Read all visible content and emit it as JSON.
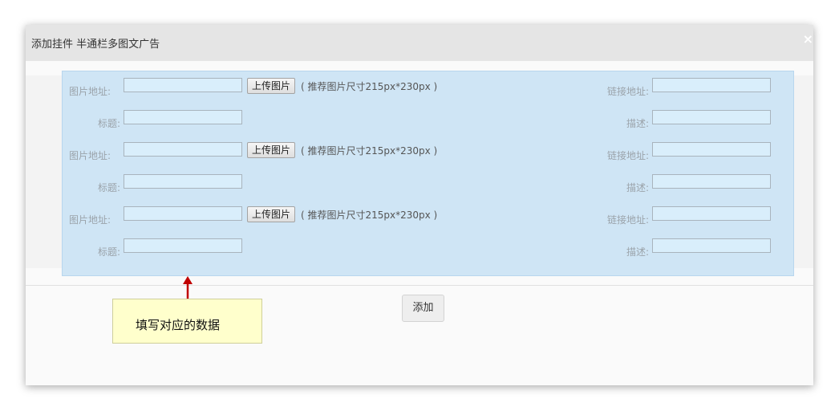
{
  "dialog": {
    "title": "添加挂件 半通栏多图文广告",
    "close_glyph": "×"
  },
  "form": {
    "rows": [
      {
        "image_label": "图片地址:",
        "upload_label": "上传图片",
        "hint": "( 推荐图片尺寸215px*230px )",
        "link_label": "链接地址:",
        "title_label": "标题:",
        "desc_label": "描述:",
        "image_value": "",
        "link_value": "",
        "title_value": "",
        "desc_value": ""
      },
      {
        "image_label": "图片地址:",
        "upload_label": "上传图片",
        "hint": "( 推荐图片尺寸215px*230px )",
        "link_label": "链接地址:",
        "title_label": "标题:",
        "desc_label": "描述:",
        "image_value": "",
        "link_value": "",
        "title_value": "",
        "desc_value": ""
      },
      {
        "image_label": "图片地址:",
        "upload_label": "上传图片",
        "hint": "( 推荐图片尺寸215px*230px )",
        "link_label": "链接地址:",
        "title_label": "标题:",
        "desc_label": "描述:",
        "image_value": "",
        "link_value": "",
        "title_value": "",
        "desc_value": ""
      }
    ]
  },
  "actions": {
    "add_label": "添加"
  },
  "annotation": {
    "text": "填写对应的数据"
  },
  "colors": {
    "panel": "#cfe5f5",
    "arrow": "#c00000",
    "callout": "#ffffcc"
  }
}
